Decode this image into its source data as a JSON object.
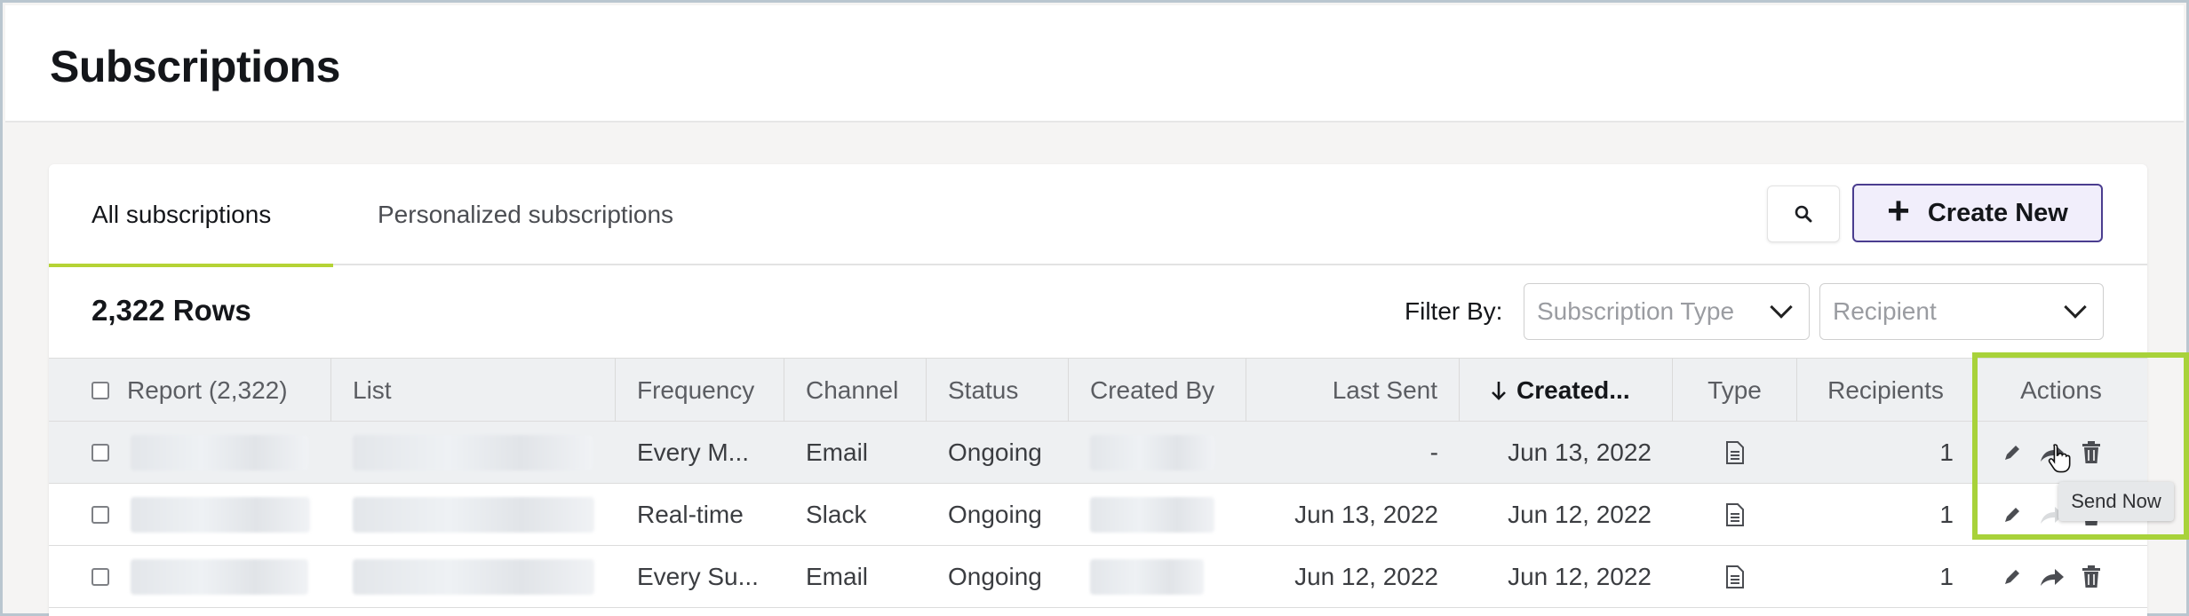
{
  "page": {
    "title": "Subscriptions"
  },
  "tabs": [
    {
      "label": "All subscriptions",
      "active": true
    },
    {
      "label": "Personalized subscriptions",
      "active": false
    }
  ],
  "toolbar": {
    "search_icon": "search-icon",
    "create_label": "Create New"
  },
  "summary": {
    "rows_label": "2,322 Rows"
  },
  "filters": {
    "label": "Filter By:",
    "subscription_type_placeholder": "Subscription Type",
    "recipient_placeholder": "Recipient"
  },
  "table": {
    "columns": {
      "report": "Report (2,322)",
      "list": "List",
      "frequency": "Frequency",
      "channel": "Channel",
      "status": "Status",
      "created_by": "Created By",
      "last_sent": "Last Sent",
      "created": "Created...",
      "type": "Type",
      "recipients": "Recipients",
      "actions": "Actions"
    },
    "sorted_column": "created",
    "sort_direction": "descending",
    "rows": [
      {
        "frequency": "Every M...",
        "channel": "Email",
        "status": "Ongoing",
        "last_sent": "-",
        "created": "Jun 13, 2022",
        "recipients": "1"
      },
      {
        "frequency": "Real-time",
        "channel": "Slack",
        "status": "Ongoing",
        "last_sent": "Jun 13, 2022",
        "created": "Jun 12, 2022",
        "recipients": "1"
      },
      {
        "frequency": "Every Su...",
        "channel": "Email",
        "status": "Ongoing",
        "last_sent": "Jun 12, 2022",
        "created": "Jun 12, 2022",
        "recipients": "1"
      }
    ]
  },
  "tooltip": {
    "text": "Send Now"
  },
  "colors": {
    "accent": "#b5d335",
    "create_border": "#4a3d8f",
    "highlight": "#a8d23a"
  }
}
